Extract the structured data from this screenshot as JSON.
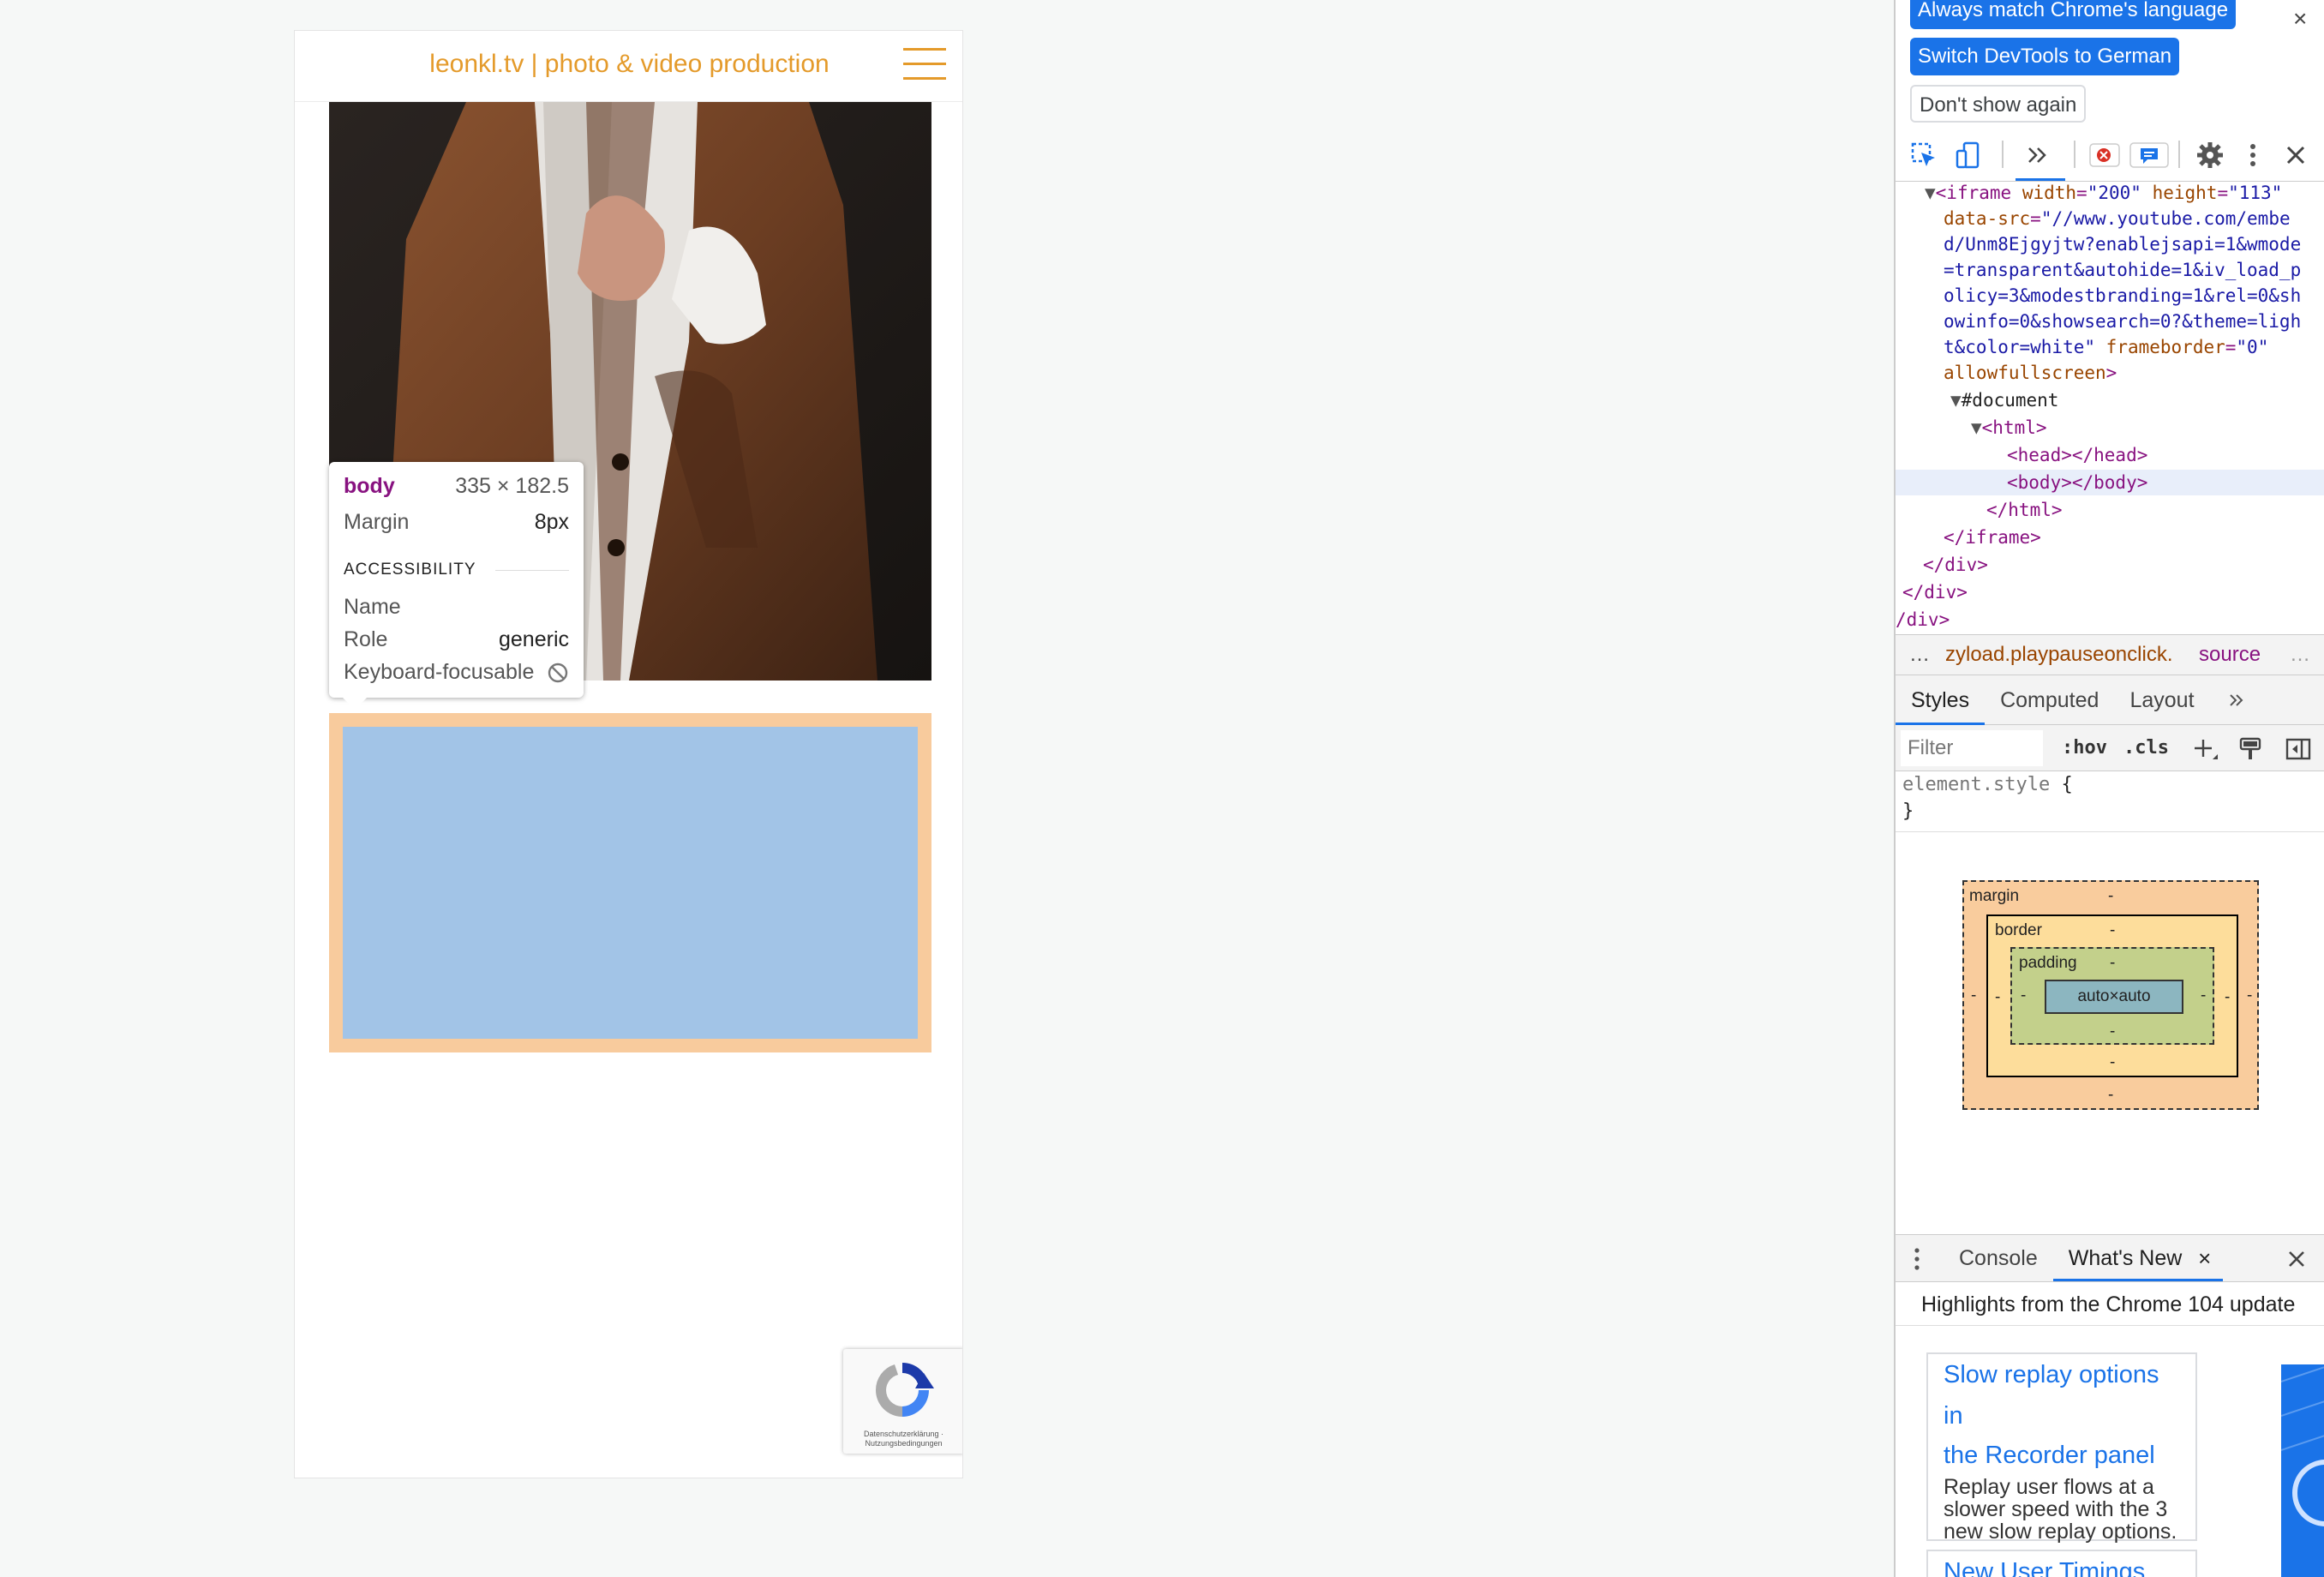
{
  "page": {
    "site_title": "leonkl.tv | photo & video production",
    "tooltip": {
      "tag": "body",
      "dimensions": "335 × 182.5",
      "margin_label": "Margin",
      "margin_value": "8px",
      "section": "ACCESSIBILITY",
      "name_label": "Name",
      "role_label": "Role",
      "role_value": "generic",
      "focusable_label": "Keyboard-focusable"
    },
    "recaptcha": {
      "links": "Datenschutzerklärung · Nutzungsbedingungen"
    }
  },
  "devtools": {
    "banner": {
      "match_language": "Always match Chrome's language",
      "switch_german": "Switch DevTools to German",
      "dont_show": "Don't show again"
    },
    "elements": {
      "iframe_open": "<iframe",
      "width_attr": "width",
      "width_val": "\"200\"",
      "height_attr": "height",
      "height_val": "\"113\"",
      "data_src_attr": "data-src",
      "data_src_lines": [
        "\"//www.youtube.com/embe",
        "d/Unm8Ejgyjtw?enablejsapi=1&wmode",
        "=transparent&autohide=1&iv_load_p",
        "olicy=3&modestbranding=1&rel=0&sh",
        "owinfo=0&showsearch=0?&theme=ligh",
        "t&color=white\""
      ],
      "frameborder_attr": "frameborder",
      "frameborder_val": "\"0\"",
      "allowfullscreen": "allowfullscreen",
      "document": "#document",
      "html_open": "<html>",
      "head": "<head></head>",
      "body": "<body></body>",
      "html_close": "</html>",
      "iframe_close": "</iframe>",
      "div_close": "</div>",
      "div_close_partial": "/div>"
    },
    "breadcrumb": {
      "more": "…",
      "current": "zyload.playpauseonclick.",
      "source": "source",
      "trailing": "…"
    },
    "styles_tabs": [
      "Styles",
      "Computed",
      "Layout"
    ],
    "filter": {
      "placeholder": "Filter",
      "hov": ":hov",
      "cls": ".cls"
    },
    "element_style": {
      "selector": "element.style",
      "open": "{",
      "close": "}"
    },
    "box_model": {
      "margin": "margin",
      "border": "border",
      "padding": "padding",
      "content": "auto×auto",
      "dash": "-"
    },
    "drawer": {
      "tabs": [
        "Console",
        "What's New"
      ],
      "highlights": "Highlights from the Chrome 104 update",
      "card1_title_1": "Slow replay options in",
      "card1_title_2": "the Recorder panel",
      "card1_desc": "Replay user flows at a slower speed with the 3 new slow replay options.",
      "card2_title": "New User Timings"
    }
  }
}
